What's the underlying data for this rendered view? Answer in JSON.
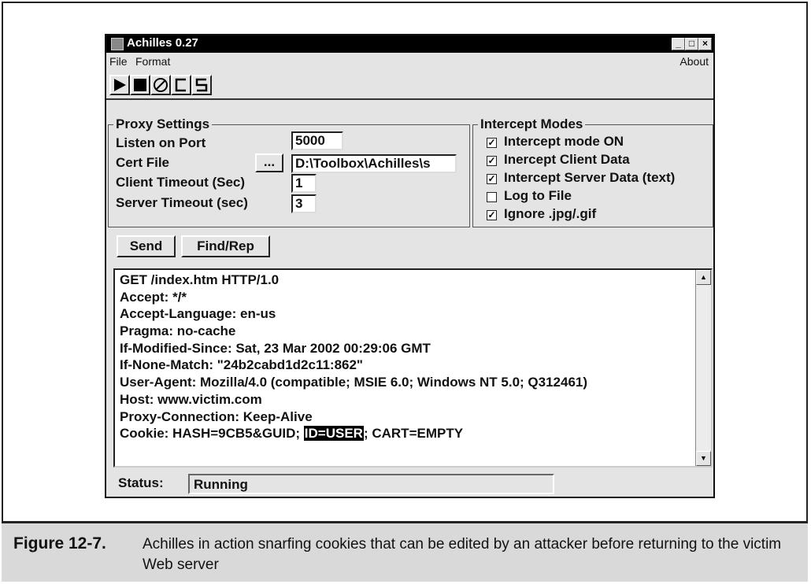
{
  "window": {
    "title": "Achilles 0.27",
    "minimize_glyph": "_",
    "maximize_glyph": "□",
    "close_glyph": "×"
  },
  "menu": {
    "file": "File",
    "format": "Format",
    "about": "About"
  },
  "toolbar": {
    "icons": [
      "play-icon",
      "stop-icon",
      "clear-icon",
      "c-icon",
      "s-icon"
    ]
  },
  "proxy_settings": {
    "title": "Proxy Settings",
    "listen_port_label": "Listen on Port",
    "listen_port_value": "5000",
    "cert_file_label": "Cert File",
    "cert_browse_label": "...",
    "cert_file_value": "D:\\Toolbox\\Achilles\\s",
    "client_timeout_label": "Client Timeout (Sec)",
    "client_timeout_value": "1",
    "server_timeout_label": "Server Timeout (sec)",
    "server_timeout_value": "3"
  },
  "intercept_modes": {
    "title": "Intercept Modes",
    "options": [
      {
        "label": "Intercept mode ON",
        "checked": true
      },
      {
        "label": "Inercept Client Data",
        "checked": true
      },
      {
        "label": "Intercept Server Data (text)",
        "checked": true
      },
      {
        "label": "Log to File",
        "checked": false
      },
      {
        "label": "Ignore .jpg/.gif",
        "checked": true
      }
    ]
  },
  "actions": {
    "send": "Send",
    "find_rep": "Find/Rep"
  },
  "request": {
    "lines": [
      "GET /index.htm HTTP/1.0",
      "Accept: */*",
      "Accept-Language: en-us",
      "Pragma: no-cache",
      "If-Modified-Since: Sat, 23 Mar 2002 00:29:06 GMT",
      "If-None-Match: \"24b2cabd1d2c11:862\"",
      "User-Agent: Mozilla/4.0 (compatible; MSIE 6.0; Windows NT 5.0; Q312461)",
      "Host: www.victim.com",
      "Proxy-Connection: Keep-Alive"
    ],
    "cookie_prefix": "Cookie: HASH=9CB5&GUID; ",
    "cookie_selected": "ID=USER",
    "cookie_suffix": "; CART=EMPTY"
  },
  "status": {
    "label": "Status:",
    "value": "Running"
  },
  "caption": {
    "label": "Figure 12-7.",
    "text": "Achilles in action snarfing cookies that can be edited by an attacker before returning to the victim Web server"
  }
}
